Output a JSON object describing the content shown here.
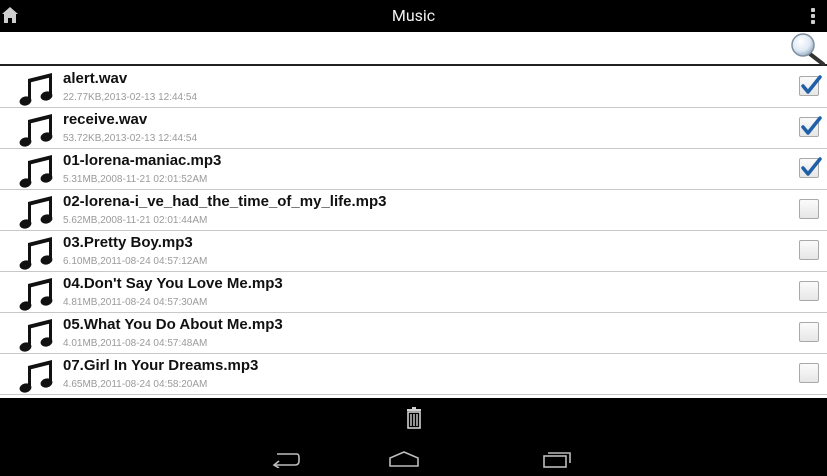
{
  "app": {
    "title": "Music"
  },
  "search": {
    "value": "",
    "placeholder": ""
  },
  "files": [
    {
      "name": "alert.wav",
      "meta": "22.77KB,2013-02-13 12:44:54",
      "checked": true
    },
    {
      "name": "receive.wav",
      "meta": "53.72KB,2013-02-13 12:44:54",
      "checked": true
    },
    {
      "name": "01-lorena-maniac.mp3",
      "meta": "5.31MB,2008-11-21 02:01:52AM",
      "checked": true
    },
    {
      "name": "02-lorena-i_ve_had_the_time_of_my_life.mp3",
      "meta": "5.62MB,2008-11-21 02:01:44AM",
      "checked": false
    },
    {
      "name": "03.Pretty Boy.mp3",
      "meta": "6.10MB,2011-08-24 04:57:12AM",
      "checked": false
    },
    {
      "name": "04.Don't Say You Love Me.mp3",
      "meta": "4.81MB,2011-08-24 04:57:30AM",
      "checked": false
    },
    {
      "name": "05.What You Do About Me.mp3",
      "meta": "4.01MB,2011-08-24 04:57:48AM",
      "checked": false
    },
    {
      "name": "07.Girl In Your Dreams.mp3",
      "meta": "4.65MB,2011-08-24 04:58:20AM",
      "checked": false
    }
  ],
  "icons": {
    "home": "home-icon",
    "overflow": "overflow-menu-icon",
    "search": "search-icon",
    "file": "music-note-icon",
    "checkbox": "checkbox-icon",
    "delete": "trash-icon",
    "back": "back-icon",
    "home_nav": "home-nav-icon",
    "recents": "recents-icon"
  },
  "colors": {
    "bar_background": "#000000",
    "list_background": "#ffffff",
    "check_mark": "#1f5fa8",
    "file_name": "#111111",
    "file_meta": "#9a9a9a"
  }
}
